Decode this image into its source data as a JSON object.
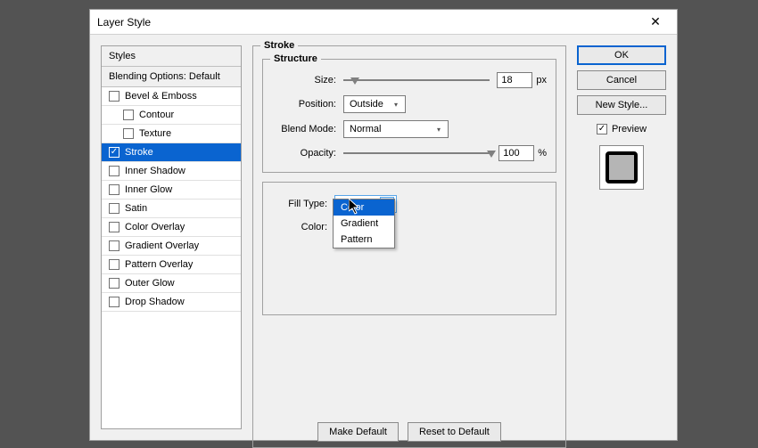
{
  "window": {
    "title": "Layer Style"
  },
  "sidebar": {
    "header": "Styles",
    "subheader": "Blending Options: Default",
    "items": [
      {
        "label": "Bevel & Emboss",
        "checked": false,
        "selected": false,
        "indent": false
      },
      {
        "label": "Contour",
        "checked": false,
        "selected": false,
        "indent": true
      },
      {
        "label": "Texture",
        "checked": false,
        "selected": false,
        "indent": true
      },
      {
        "label": "Stroke",
        "checked": true,
        "selected": true,
        "indent": false
      },
      {
        "label": "Inner Shadow",
        "checked": false,
        "selected": false,
        "indent": false
      },
      {
        "label": "Inner Glow",
        "checked": false,
        "selected": false,
        "indent": false
      },
      {
        "label": "Satin",
        "checked": false,
        "selected": false,
        "indent": false
      },
      {
        "label": "Color Overlay",
        "checked": false,
        "selected": false,
        "indent": false
      },
      {
        "label": "Gradient Overlay",
        "checked": false,
        "selected": false,
        "indent": false
      },
      {
        "label": "Pattern Overlay",
        "checked": false,
        "selected": false,
        "indent": false
      },
      {
        "label": "Outer Glow",
        "checked": false,
        "selected": false,
        "indent": false
      },
      {
        "label": "Drop Shadow",
        "checked": false,
        "selected": false,
        "indent": false
      }
    ]
  },
  "stroke": {
    "section_label": "Stroke",
    "structure_label": "Structure",
    "size_label": "Size:",
    "size_value": "18",
    "size_unit": "px",
    "position_label": "Position:",
    "position_value": "Outside",
    "blendmode_label": "Blend Mode:",
    "blendmode_value": "Normal",
    "opacity_label": "Opacity:",
    "opacity_value": "100",
    "opacity_unit": "%",
    "filltype_label": "Fill Type:",
    "filltype_value": "Color",
    "filltype_options": [
      "Color",
      "Gradient",
      "Pattern"
    ],
    "color_label": "Color:",
    "color_value": "#000000",
    "make_default": "Make Default",
    "reset_default": "Reset to Default"
  },
  "right": {
    "ok": "OK",
    "cancel": "Cancel",
    "new_style": "New Style...",
    "preview": "Preview"
  }
}
